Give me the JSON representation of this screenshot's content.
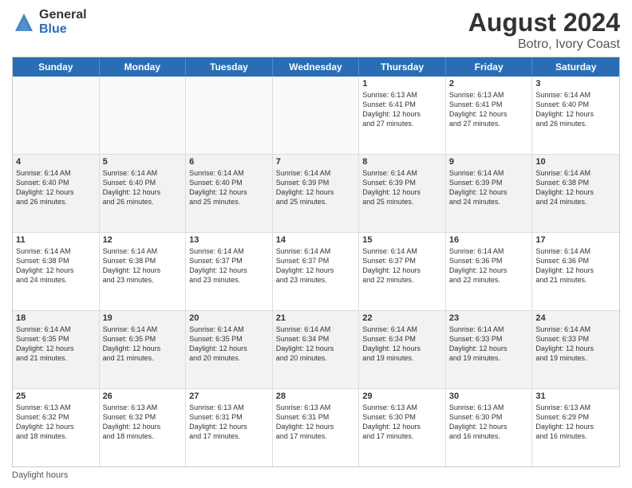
{
  "header": {
    "logo_general": "General",
    "logo_blue": "Blue",
    "main_title": "August 2024",
    "subtitle": "Botro, Ivory Coast"
  },
  "days_of_week": [
    "Sunday",
    "Monday",
    "Tuesday",
    "Wednesday",
    "Thursday",
    "Friday",
    "Saturday"
  ],
  "footer": {
    "note": "Daylight hours"
  },
  "weeks": [
    [
      {
        "day": "",
        "info": "",
        "empty": true
      },
      {
        "day": "",
        "info": "",
        "empty": true
      },
      {
        "day": "",
        "info": "",
        "empty": true
      },
      {
        "day": "",
        "info": "",
        "empty": true
      },
      {
        "day": "1",
        "info": "Sunrise: 6:13 AM\nSunset: 6:41 PM\nDaylight: 12 hours\nand 27 minutes."
      },
      {
        "day": "2",
        "info": "Sunrise: 6:13 AM\nSunset: 6:41 PM\nDaylight: 12 hours\nand 27 minutes."
      },
      {
        "day": "3",
        "info": "Sunrise: 6:14 AM\nSunset: 6:40 PM\nDaylight: 12 hours\nand 26 minutes."
      }
    ],
    [
      {
        "day": "4",
        "info": "Sunrise: 6:14 AM\nSunset: 6:40 PM\nDaylight: 12 hours\nand 26 minutes."
      },
      {
        "day": "5",
        "info": "Sunrise: 6:14 AM\nSunset: 6:40 PM\nDaylight: 12 hours\nand 26 minutes."
      },
      {
        "day": "6",
        "info": "Sunrise: 6:14 AM\nSunset: 6:40 PM\nDaylight: 12 hours\nand 25 minutes."
      },
      {
        "day": "7",
        "info": "Sunrise: 6:14 AM\nSunset: 6:39 PM\nDaylight: 12 hours\nand 25 minutes."
      },
      {
        "day": "8",
        "info": "Sunrise: 6:14 AM\nSunset: 6:39 PM\nDaylight: 12 hours\nand 25 minutes."
      },
      {
        "day": "9",
        "info": "Sunrise: 6:14 AM\nSunset: 6:39 PM\nDaylight: 12 hours\nand 24 minutes."
      },
      {
        "day": "10",
        "info": "Sunrise: 6:14 AM\nSunset: 6:38 PM\nDaylight: 12 hours\nand 24 minutes."
      }
    ],
    [
      {
        "day": "11",
        "info": "Sunrise: 6:14 AM\nSunset: 6:38 PM\nDaylight: 12 hours\nand 24 minutes."
      },
      {
        "day": "12",
        "info": "Sunrise: 6:14 AM\nSunset: 6:38 PM\nDaylight: 12 hours\nand 23 minutes."
      },
      {
        "day": "13",
        "info": "Sunrise: 6:14 AM\nSunset: 6:37 PM\nDaylight: 12 hours\nand 23 minutes."
      },
      {
        "day": "14",
        "info": "Sunrise: 6:14 AM\nSunset: 6:37 PM\nDaylight: 12 hours\nand 23 minutes."
      },
      {
        "day": "15",
        "info": "Sunrise: 6:14 AM\nSunset: 6:37 PM\nDaylight: 12 hours\nand 22 minutes."
      },
      {
        "day": "16",
        "info": "Sunrise: 6:14 AM\nSunset: 6:36 PM\nDaylight: 12 hours\nand 22 minutes."
      },
      {
        "day": "17",
        "info": "Sunrise: 6:14 AM\nSunset: 6:36 PM\nDaylight: 12 hours\nand 21 minutes."
      }
    ],
    [
      {
        "day": "18",
        "info": "Sunrise: 6:14 AM\nSunset: 6:35 PM\nDaylight: 12 hours\nand 21 minutes."
      },
      {
        "day": "19",
        "info": "Sunrise: 6:14 AM\nSunset: 6:35 PM\nDaylight: 12 hours\nand 21 minutes."
      },
      {
        "day": "20",
        "info": "Sunrise: 6:14 AM\nSunset: 6:35 PM\nDaylight: 12 hours\nand 20 minutes."
      },
      {
        "day": "21",
        "info": "Sunrise: 6:14 AM\nSunset: 6:34 PM\nDaylight: 12 hours\nand 20 minutes."
      },
      {
        "day": "22",
        "info": "Sunrise: 6:14 AM\nSunset: 6:34 PM\nDaylight: 12 hours\nand 19 minutes."
      },
      {
        "day": "23",
        "info": "Sunrise: 6:14 AM\nSunset: 6:33 PM\nDaylight: 12 hours\nand 19 minutes."
      },
      {
        "day": "24",
        "info": "Sunrise: 6:14 AM\nSunset: 6:33 PM\nDaylight: 12 hours\nand 19 minutes."
      }
    ],
    [
      {
        "day": "25",
        "info": "Sunrise: 6:13 AM\nSunset: 6:32 PM\nDaylight: 12 hours\nand 18 minutes."
      },
      {
        "day": "26",
        "info": "Sunrise: 6:13 AM\nSunset: 6:32 PM\nDaylight: 12 hours\nand 18 minutes."
      },
      {
        "day": "27",
        "info": "Sunrise: 6:13 AM\nSunset: 6:31 PM\nDaylight: 12 hours\nand 17 minutes."
      },
      {
        "day": "28",
        "info": "Sunrise: 6:13 AM\nSunset: 6:31 PM\nDaylight: 12 hours\nand 17 minutes."
      },
      {
        "day": "29",
        "info": "Sunrise: 6:13 AM\nSunset: 6:30 PM\nDaylight: 12 hours\nand 17 minutes."
      },
      {
        "day": "30",
        "info": "Sunrise: 6:13 AM\nSunset: 6:30 PM\nDaylight: 12 hours\nand 16 minutes."
      },
      {
        "day": "31",
        "info": "Sunrise: 6:13 AM\nSunset: 6:29 PM\nDaylight: 12 hours\nand 16 minutes."
      }
    ]
  ]
}
